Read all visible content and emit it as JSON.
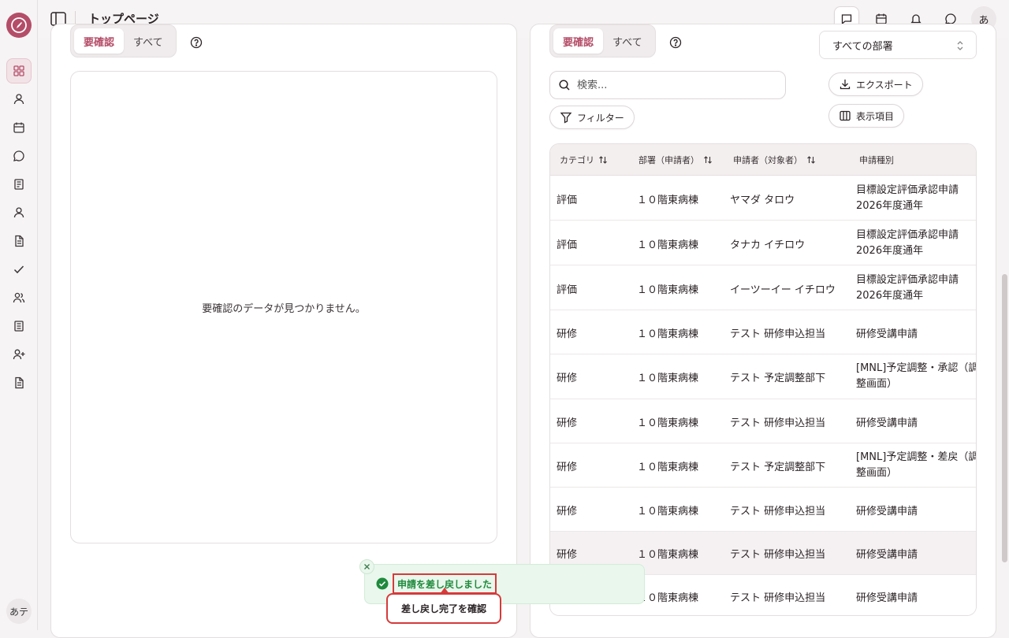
{
  "header": {
    "title": "トップページ",
    "user_initial": "あ"
  },
  "sidebar": {
    "user_initial": "あテ",
    "items": [
      {
        "icon": "dashboard-icon"
      },
      {
        "icon": "user-icon"
      },
      {
        "icon": "calendar-icon"
      },
      {
        "icon": "chat-icon"
      },
      {
        "icon": "book-icon"
      },
      {
        "icon": "person-icon"
      },
      {
        "icon": "document-icon"
      },
      {
        "icon": "check-icon"
      },
      {
        "icon": "users-icon"
      },
      {
        "icon": "notebook-icon"
      },
      {
        "icon": "user-plus-icon"
      },
      {
        "icon": "file-icon"
      }
    ]
  },
  "left_panel": {
    "tabs": [
      "要確認",
      "すべて"
    ],
    "empty_message": "要確認のデータが見つかりません。"
  },
  "right_panel": {
    "tabs": [
      "要確認",
      "すべて"
    ],
    "department_select": "すべての部署",
    "search_placeholder": "検索...",
    "filter_label": "フィルター",
    "export_label": "エクスポート",
    "columns_label": "表示項目",
    "columns": [
      "カテゴリ",
      "部署（申請者）",
      "申請者（対象者）",
      "申請種別"
    ],
    "rows": [
      {
        "category": "評価",
        "dept": "１０階東病棟",
        "applicant": "ヤマダ タロウ",
        "type": "目標設定評価承認申請 2026年度通年"
      },
      {
        "category": "評価",
        "dept": "１０階東病棟",
        "applicant": "タナカ イチロウ",
        "type": "目標設定評価承認申請 2026年度通年"
      },
      {
        "category": "評価",
        "dept": "１０階東病棟",
        "applicant": "イーツーイー イチロウ",
        "type": "目標設定評価承認申請 2026年度通年"
      },
      {
        "category": "研修",
        "dept": "１０階東病棟",
        "applicant": "テスト 研修申込担当",
        "type": "研修受講申請"
      },
      {
        "category": "研修",
        "dept": "１０階東病棟",
        "applicant": "テスト 予定調整部下",
        "type": "[MNL]予定調整・承認（調整画面）"
      },
      {
        "category": "研修",
        "dept": "１０階東病棟",
        "applicant": "テスト 研修申込担当",
        "type": "研修受講申請"
      },
      {
        "category": "研修",
        "dept": "１０階東病棟",
        "applicant": "テスト 予定調整部下",
        "type": "[MNL]予定調整・差戻（調整画面）"
      },
      {
        "category": "研修",
        "dept": "１０階東病棟",
        "applicant": "テスト 研修申込担当",
        "type": "研修受講申請"
      },
      {
        "category": "研修",
        "dept": "１０階東病棟",
        "applicant": "テスト 研修申込担当",
        "type": "研修受講申請"
      },
      {
        "category": "研修",
        "dept": "１０階東病棟",
        "applicant": "テスト 研修申込担当",
        "type": "研修受講申請"
      }
    ]
  },
  "toast": {
    "message": "申請を差し戻しました",
    "tooltip": "差し戻し完了を確認"
  },
  "colors": {
    "accent": "#b44d68",
    "success": "#1f8a3c",
    "highlight": "#d63a3a"
  }
}
